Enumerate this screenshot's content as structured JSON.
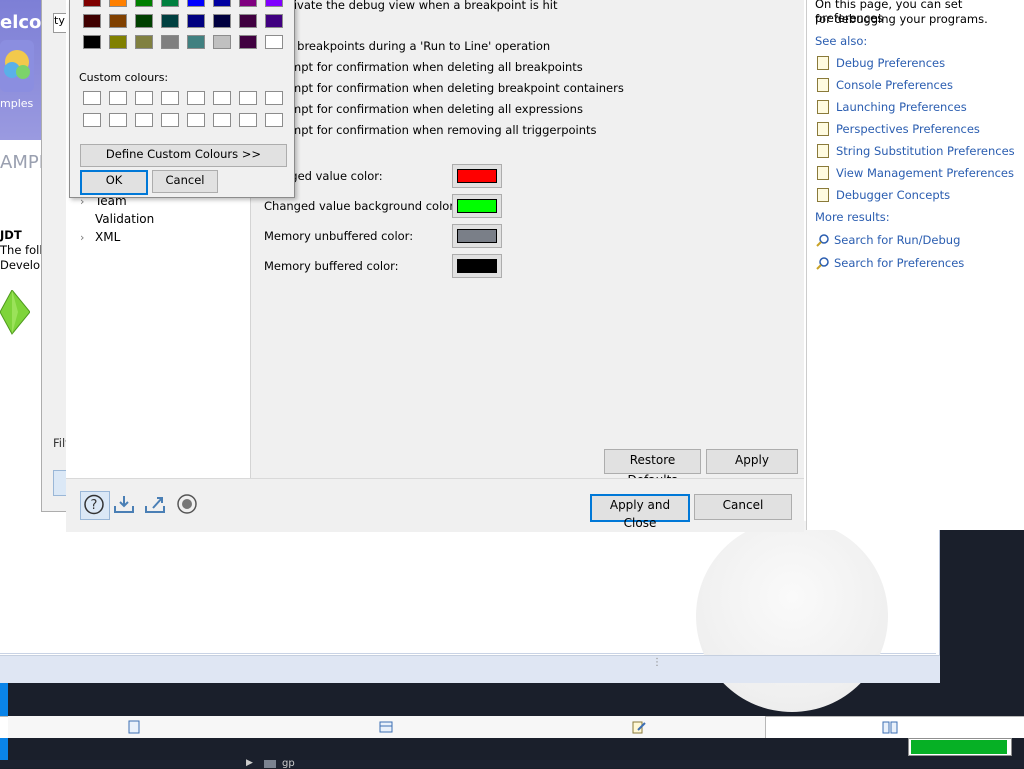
{
  "welcome": {
    "title": "elcor",
    "samples_label": "mples",
    "samples_heading": "AMPL",
    "jdt_label": "JDT",
    "jdt_desc_1": "The foll",
    "jdt_desc_2": "Develop"
  },
  "prefs_frame": {
    "filter_label": "Filt",
    "search_text": "ty"
  },
  "tree": {
    "items": [
      {
        "label": "Team",
        "has_arrow": true
      },
      {
        "label": "Validation",
        "has_arrow": false
      },
      {
        "label": "XML",
        "has_arrow": true
      }
    ]
  },
  "content": {
    "lines": [
      "ctivate the debug view when a breakpoint is hit",
      "ip breakpoints during a 'Run to Line' operation",
      "ompt for confirmation when deleting all breakpoints",
      "ompt for confirmation when deleting breakpoint containers",
      "ompt for confirmation when deleting all expressions",
      "ompt for confirmation when removing all triggerpoints"
    ],
    "colors": [
      {
        "label": "nged value color:",
        "swatch": "#ff0000"
      },
      {
        "label": "Changed value background color:",
        "swatch": "#00ff00"
      },
      {
        "label": "Memory unbuffered color:",
        "swatch": "#7a7f88"
      },
      {
        "label": "Memory buffered color:",
        "swatch": "#000000"
      }
    ],
    "restore_defaults": "Restore Defaults",
    "apply": "Apply"
  },
  "footer": {
    "apply_close": "Apply and Close",
    "cancel": "Cancel"
  },
  "help": {
    "intro_1": "On this page, you can set preferences",
    "intro_2": "for debugging your programs.",
    "see_also": "See also:",
    "links": [
      "Debug Preferences",
      "Console Preferences",
      "Launching Preferences",
      "Perspectives Preferences",
      "String Substitution Preferences",
      "View Management Preferences",
      "Debugger Concepts"
    ],
    "more_results": "More results:",
    "searches": [
      "Search for Run/Debug",
      "Search for Preferences"
    ]
  },
  "colour_dialog": {
    "basic_rows": [
      [
        "#800000",
        "#ff8000",
        "#008000",
        "#008040",
        "#0000ff",
        "#0000a0",
        "#800080",
        "#8000ff"
      ],
      [
        "#400000",
        "#804000",
        "#004000",
        "#004040",
        "#000080",
        "#000040",
        "#400040",
        "#400080"
      ],
      [
        "#000000",
        "#808000",
        "#808040",
        "#808080",
        "#408080",
        "#c0c0c0",
        "#400040",
        "#ffffff"
      ]
    ],
    "custom_label": "Custom colours:",
    "define_button": "Define Custom Colours >>",
    "ok": "OK",
    "cancel": "Cancel"
  },
  "status": {
    "progress_fraction": 0.96,
    "progress_color": "#06b025",
    "tray_text": "gp"
  }
}
